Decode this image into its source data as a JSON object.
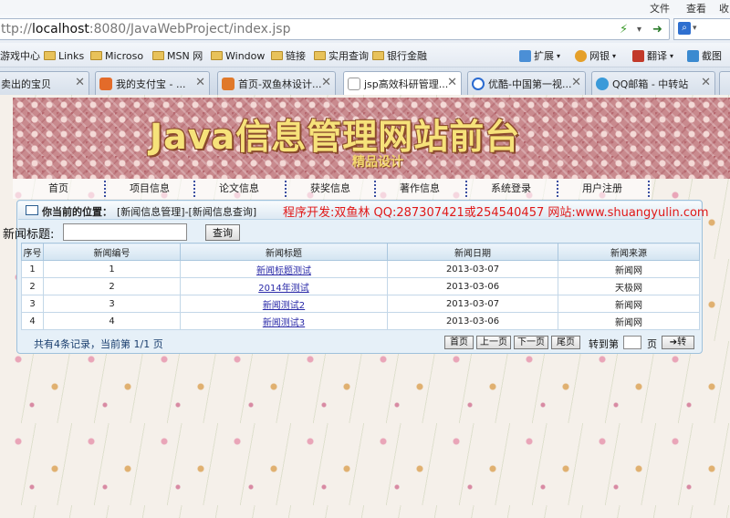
{
  "menubar": {
    "items": [
      "文件",
      "查看",
      "收"
    ]
  },
  "address": {
    "prefix": "ttp://",
    "host": "localhost",
    "rest": ":8080/JavaWebProject/index.jsp"
  },
  "bookmarks": [
    "游戏中心",
    "Links",
    "Microso",
    "MSN 网",
    "Window",
    "链接",
    "实用查询",
    "银行金融"
  ],
  "toolbar": {
    "expand": "扩展",
    "bank": "网银",
    "translate": "翻译",
    "screenshot": "截图"
  },
  "tabs": [
    {
      "label": "卖出的宝贝",
      "active": false
    },
    {
      "label": "我的支付宝 - ...",
      "active": false
    },
    {
      "label": "首页-双鱼林设计...",
      "active": false
    },
    {
      "label": "jsp高效科研管理...",
      "active": true
    },
    {
      "label": "优酷-中国第一视...",
      "active": false
    },
    {
      "label": "QQ邮箱 - 中转站",
      "active": false
    }
  ],
  "banner": {
    "title": "Java信息管理网站前台",
    "subtitle": "精品设计"
  },
  "nav": [
    "首页",
    "项目信息",
    "论文信息",
    "获奖信息",
    "著作信息",
    "系统登录",
    "用户注册"
  ],
  "location": {
    "label": "你当前的位置：",
    "path": "[新闻信息管理]-[新闻信息查询]"
  },
  "developer": "程序开发:双鱼林 QQ:287307421或254540457 网站:www.shuangyulin.com",
  "search": {
    "label": "新闻标题:",
    "value": "",
    "button": "查询"
  },
  "table": {
    "headers": [
      "序号",
      "新闻编号",
      "新闻标题",
      "新闻日期",
      "新闻来源"
    ],
    "rows": [
      [
        "1",
        "1",
        "新闻标题测试",
        "2013-03-07",
        "新闻网"
      ],
      [
        "2",
        "2",
        "2014年测试",
        "2013-03-06",
        "天极网"
      ],
      [
        "3",
        "3",
        "新闻测试2",
        "2013-03-07",
        "新闻网"
      ],
      [
        "4",
        "4",
        "新闻测试3",
        "2013-03-06",
        "新闻网"
      ]
    ]
  },
  "pager": {
    "info": "共有4条记录，当前第 1/1 页",
    "first": "首页",
    "prev": "上一页",
    "next": "下一页",
    "last": "尾页",
    "goto_label": "转到第",
    "goto_unit": "页",
    "go": "➔转"
  }
}
